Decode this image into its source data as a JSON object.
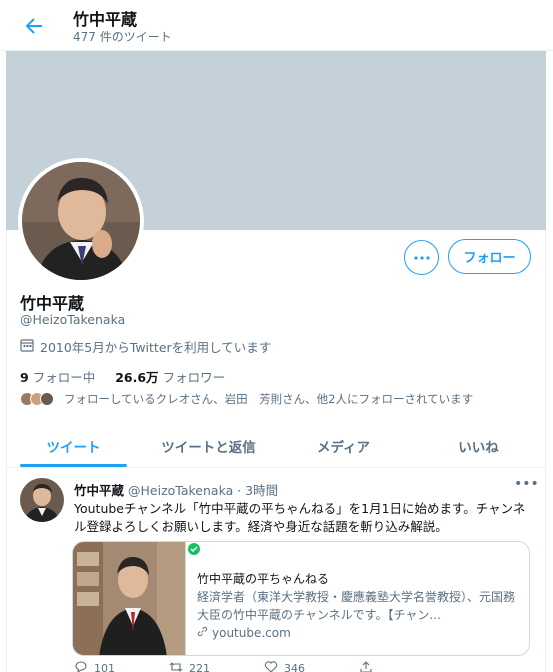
{
  "header": {
    "title": "竹中平蔵",
    "subtitle": "477 件のツイート"
  },
  "profile": {
    "name": "竹中平蔵",
    "handle": "@HeizoTakenaka",
    "joined": "2010年5月からTwitterを利用しています",
    "following_count": "9",
    "following_label": "フォロー中",
    "followers_count": "26.6万",
    "followers_label": "フォロワー",
    "known_followers": "フォローしているクレオさん、岩田　芳則さん、他2人にフォローされています",
    "more_label": "•••",
    "follow_label": "フォロー"
  },
  "tabs": [
    {
      "label": "ツイート"
    },
    {
      "label": "ツイートと返信"
    },
    {
      "label": "メディア"
    },
    {
      "label": "いいね"
    }
  ],
  "tweet": {
    "name": "竹中平蔵",
    "meta": "@HeizoTakenaka · 3時間",
    "text": "Youtubeチャンネル「竹中平蔵の平ちゃんねる」を1月1日に始めます。チャンネル登録よろしくお願いします。経済や身近な話題を斬り込み解説。",
    "card": {
      "title": "竹中平蔵の平ちゃんねる",
      "desc": "経済学者（東洋大学教授・慶應義塾大学名誉教授）、元国務大臣の竹中平蔵のチャンネルです。【チャン...",
      "url": "youtube.com"
    },
    "actions": {
      "reply": "101",
      "retweet": "221",
      "like": "346"
    }
  },
  "colors": {
    "accent": "#1da1f2",
    "banner": "#c5d1d9"
  }
}
